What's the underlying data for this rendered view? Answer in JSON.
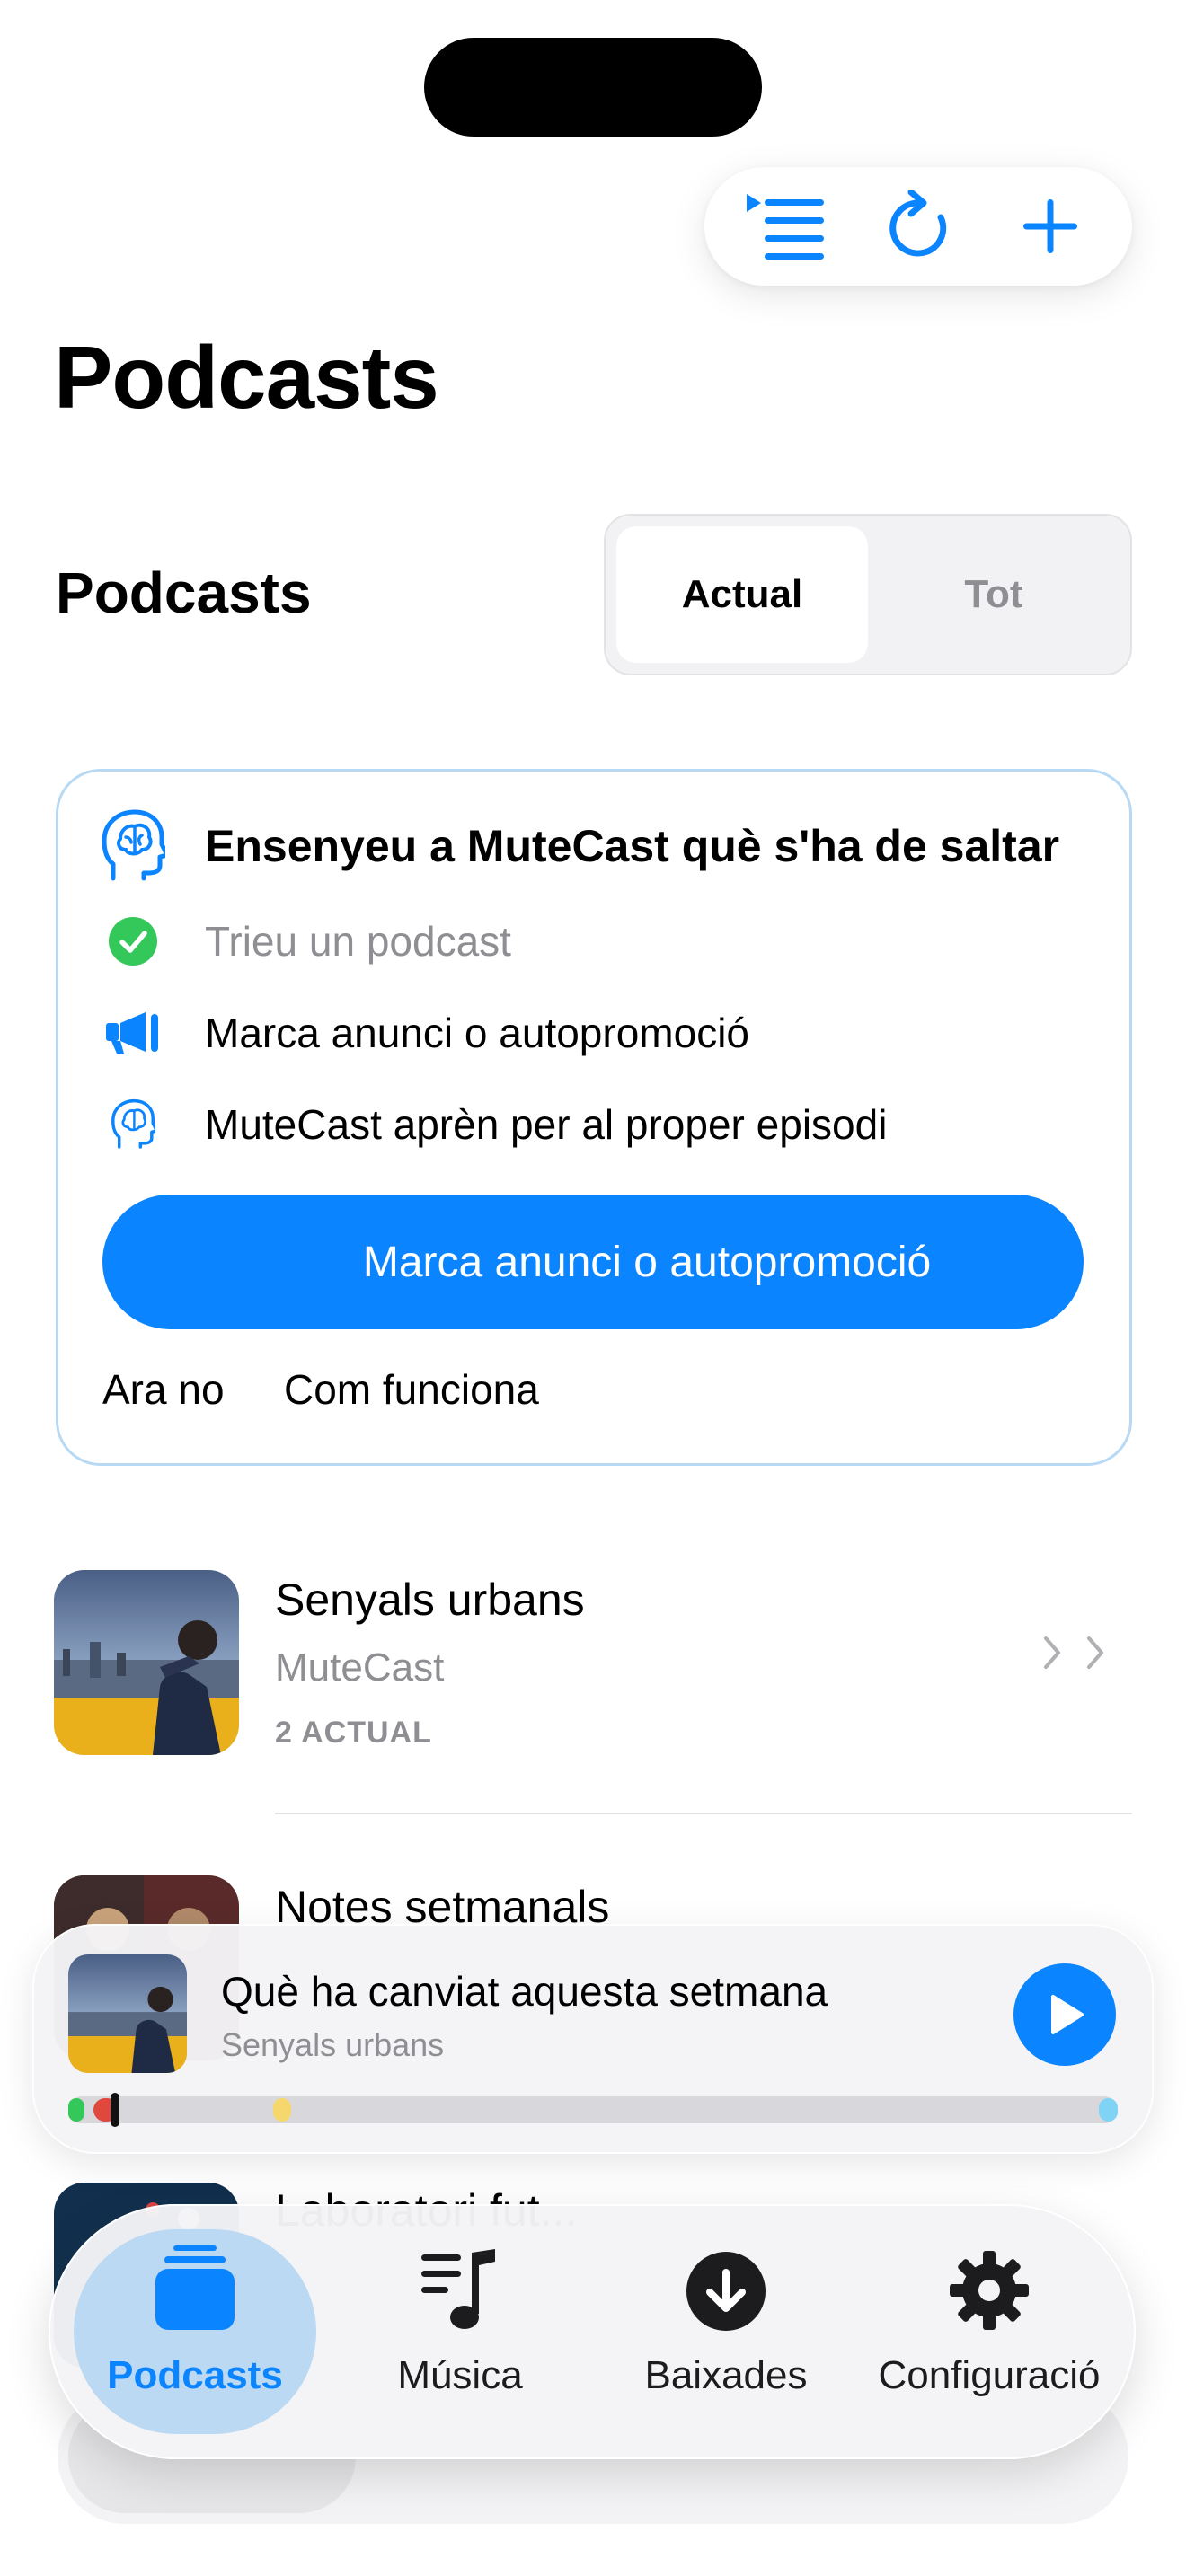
{
  "toolbar": {
    "icons": [
      "queue-list-icon",
      "refresh-icon",
      "plus-icon"
    ],
    "accent": "#0a84ff"
  },
  "page": {
    "title": "Podcasts"
  },
  "section": {
    "title": "Podcasts",
    "segments": [
      {
        "label": "Actual",
        "selected": true
      },
      {
        "label": "Tot",
        "selected": false
      }
    ]
  },
  "teach_card": {
    "heading": "Ensenyeu a MuteCast què s'ha de saltar",
    "steps": [
      {
        "label": "Trieu un podcast",
        "icon": "check-circle-icon",
        "done": true
      },
      {
        "label": "Marca anunci o autopromoció",
        "icon": "megaphone-icon",
        "done": false
      },
      {
        "label": "MuteCast aprèn per al proper episodi",
        "icon": "brain-head-icon",
        "done": false
      }
    ],
    "primary_button": "Marca anunci o autopromoció",
    "not_now": "Ara no",
    "how_it_works": "Com funciona",
    "border_color": "#b7d9f4"
  },
  "podcasts": [
    {
      "title": "Senyals urbans",
      "author": "MuteCast",
      "count": "2 ACTUAL"
    },
    {
      "title": "Notes setmanals"
    },
    {
      "title": "Laboratori fut..."
    }
  ],
  "player": {
    "title": "Què ha canviat aquesta setmana",
    "subtitle": "Senyals urbans",
    "progress": 0.04,
    "markers": [
      {
        "color": "#34c759",
        "start": 0.0,
        "end": 0.012
      },
      {
        "color": "#e0483e",
        "start": 0.024,
        "end": 0.048
      },
      {
        "color": "#f5d76e",
        "start": 0.195,
        "end": 0.212
      },
      {
        "color": "#7fd3f5",
        "start": 0.982,
        "end": 1.0
      }
    ]
  },
  "tabs": [
    {
      "label": "Podcasts",
      "icon": "podcasts-stack-icon",
      "active": true
    },
    {
      "label": "Música",
      "icon": "music-list-icon",
      "active": false
    },
    {
      "label": "Baixades",
      "icon": "download-circle-icon",
      "active": false
    },
    {
      "label": "Configuració",
      "icon": "gear-icon",
      "active": false
    }
  ]
}
